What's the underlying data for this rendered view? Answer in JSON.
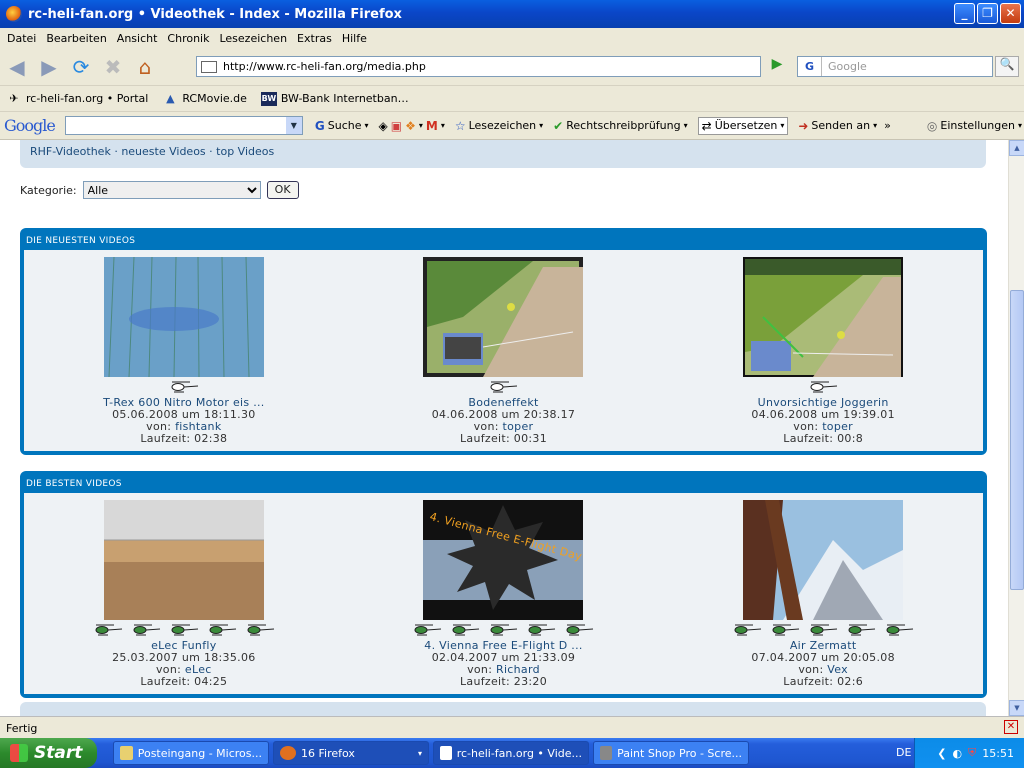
{
  "window": {
    "title": "rc-heli-fan.org • Videothek - Index - Mozilla Firefox"
  },
  "menu": [
    "Datei",
    "Bearbeiten",
    "Ansicht",
    "Chronik",
    "Lesezeichen",
    "Extras",
    "Hilfe"
  ],
  "nav": {
    "url": "http://www.rc-heli-fan.org/media.php",
    "search_placeholder": "Google"
  },
  "bookmarks": [
    "rc-heli-fan.org • Portal",
    "RCMovie.de",
    "BW-Bank Internetban…"
  ],
  "google_toolbar": {
    "logo": "Google",
    "search": "Suche",
    "lesezeichen": "Lesezeichen",
    "spell": "Rechtschreibprüfung",
    "translate": "Übersetzen",
    "senden": "Senden an",
    "settings": "Einstellungen"
  },
  "page": {
    "nav_links": [
      "RHF-Videothek",
      "neueste Videos",
      "top Videos"
    ],
    "nav_sep": "·",
    "kategorie_label": "Kategorie:",
    "kategorie_value": "Alle",
    "ok_label": "OK",
    "newest": {
      "title": "DIE NEUESTEN VIDEOS",
      "videos": [
        {
          "title": "T-Rex 600 Nitro Motor eis ...",
          "date": "05.06.2008 um 18:11.30",
          "von": "von:",
          "author": "fishtank",
          "laufzeit": "Laufzeit:",
          "duration": "02:38"
        },
        {
          "title": "Bodeneffekt",
          "date": "04.06.2008 um 20:38.17",
          "von": "von:",
          "author": "toper",
          "laufzeit": "Laufzeit:",
          "duration": "00:31"
        },
        {
          "title": "Unvorsichtige Joggerin",
          "date": "04.06.2008 um 19:39.01",
          "von": "von:",
          "author": "toper",
          "laufzeit": "Laufzeit:",
          "duration": "00:8"
        }
      ]
    },
    "best": {
      "title": "DIE BESTEN VIDEOS",
      "videos": [
        {
          "title": "eLec Funfly",
          "date": "25.03.2007 um 18:35.06",
          "von": "von:",
          "author": "eLec",
          "laufzeit": "Laufzeit:",
          "duration": "04:25"
        },
        {
          "title": "4. Vienna Free E-Flight D ...",
          "date": "02.04.2007 um 21:33.09",
          "von": "von:",
          "author": "Richard",
          "laufzeit": "Laufzeit:",
          "duration": "23:20"
        },
        {
          "title": "Air Zermatt",
          "date": "07.04.2007 um 20:05.08",
          "von": "von:",
          "author": "Vex",
          "laufzeit": "Laufzeit:",
          "duration": "02:6"
        }
      ],
      "thumb_text": "4. Vienna Free E-Flight Day"
    }
  },
  "status": "Fertig",
  "taskbar": {
    "start": "Start",
    "tasks": [
      "Posteingang - Micros...",
      "16 Firefox",
      "rc-heli-fan.org • Vide...",
      "Paint Shop Pro - Scre..."
    ],
    "lang": "DE",
    "clock": "15:51"
  }
}
